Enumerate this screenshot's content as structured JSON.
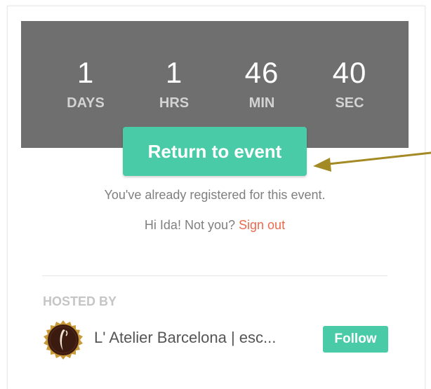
{
  "countdown": {
    "days": {
      "value": "1",
      "label": "DAYS"
    },
    "hrs": {
      "value": "1",
      "label": "HRS"
    },
    "min": {
      "value": "46",
      "label": "MIN"
    },
    "sec": {
      "value": "40",
      "label": "SEC"
    }
  },
  "actions": {
    "return_label": "Return to event"
  },
  "registration": {
    "message": "You've already registered for this event.",
    "greeting": "Hi Ida! Not you?",
    "signout_label": "Sign out"
  },
  "host": {
    "heading": "HOSTED BY",
    "name": "L' Atelier Barcelona | esc...",
    "follow_label": "Follow",
    "logo_icon": "atelier-logo-icon"
  },
  "annotation": {
    "arrow_icon": "arrow-left-icon"
  },
  "colors": {
    "accent": "#49cba8",
    "countdown_bg": "#6f6f6f",
    "link": "#ea6a4d",
    "arrow": "#a38a24"
  }
}
